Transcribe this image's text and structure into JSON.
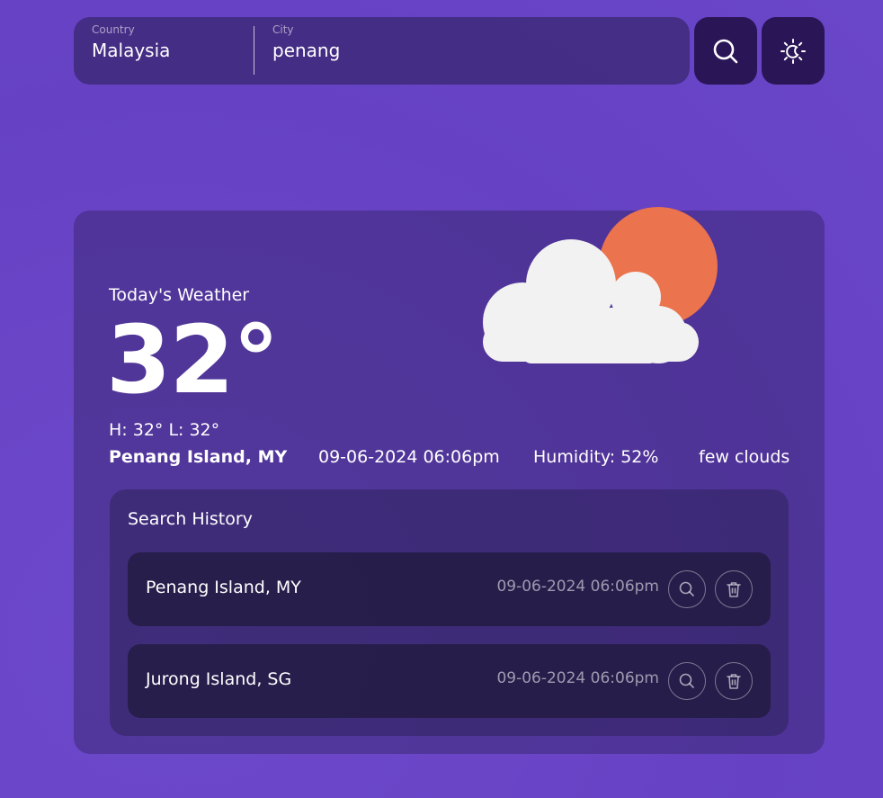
{
  "search": {
    "country_label": "Country",
    "country_value": "Malaysia",
    "city_label": "City",
    "city_value": "penang"
  },
  "icons": {
    "search": "search-icon",
    "theme": "sun-moon-icon",
    "delete": "trash-icon"
  },
  "weather": {
    "today_label": "Today's Weather",
    "temperature": "32°",
    "hilo": "H: 32° L: 32°",
    "location": "Penang Island, MY",
    "datetime": "09-06-2024 06:06pm",
    "humidity": "Humidity: 52%",
    "description": "few clouds",
    "icon": "partly-cloudy-icon"
  },
  "history": {
    "title": "Search History",
    "items": [
      {
        "location": "Penang Island, MY",
        "time": "09-06-2024 06:06pm"
      },
      {
        "location": "Jurong Island, SG",
        "time": "09-06-2024 06:06pm"
      }
    ]
  },
  "colors": {
    "background": "#6a45c6",
    "button": "#2a1657",
    "sun": "#eb734d",
    "cloud": "#f2f2f2"
  }
}
